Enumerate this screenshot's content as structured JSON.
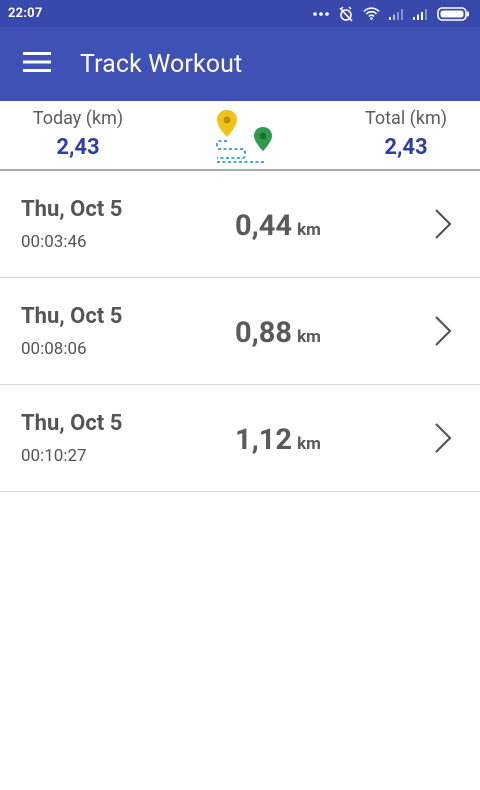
{
  "status_bar": {
    "time": "22:07",
    "icons": [
      "more-dots-icon",
      "alarm-off-icon",
      "wifi-icon",
      "signal-icon",
      "signal-icon",
      "battery-icon"
    ]
  },
  "app_bar": {
    "menu_icon": "hamburger-menu-icon",
    "title": "Track Workout"
  },
  "summary": {
    "today_label": "Today (km)",
    "today_value": "2,43",
    "total_label": "Total (km)",
    "total_value": "2,43",
    "route_icon": "route-pins-icon",
    "colors": {
      "value": "#303f9f",
      "start_pin": "#f2c21a",
      "end_pin": "#2e9b4c",
      "route_line": "#2f9fd6"
    }
  },
  "workouts": [
    {
      "date": "Thu, Oct 5",
      "duration": "00:03:46",
      "distance": "0,44",
      "unit": "km"
    },
    {
      "date": "Thu, Oct 5",
      "duration": "00:08:06",
      "distance": "0,88",
      "unit": "km"
    },
    {
      "date": "Thu, Oct 5",
      "duration": "00:10:27",
      "distance": "1,12",
      "unit": "km"
    }
  ],
  "theme": {
    "primary": "#3f51b5",
    "primary_dark": "#3948ad"
  }
}
